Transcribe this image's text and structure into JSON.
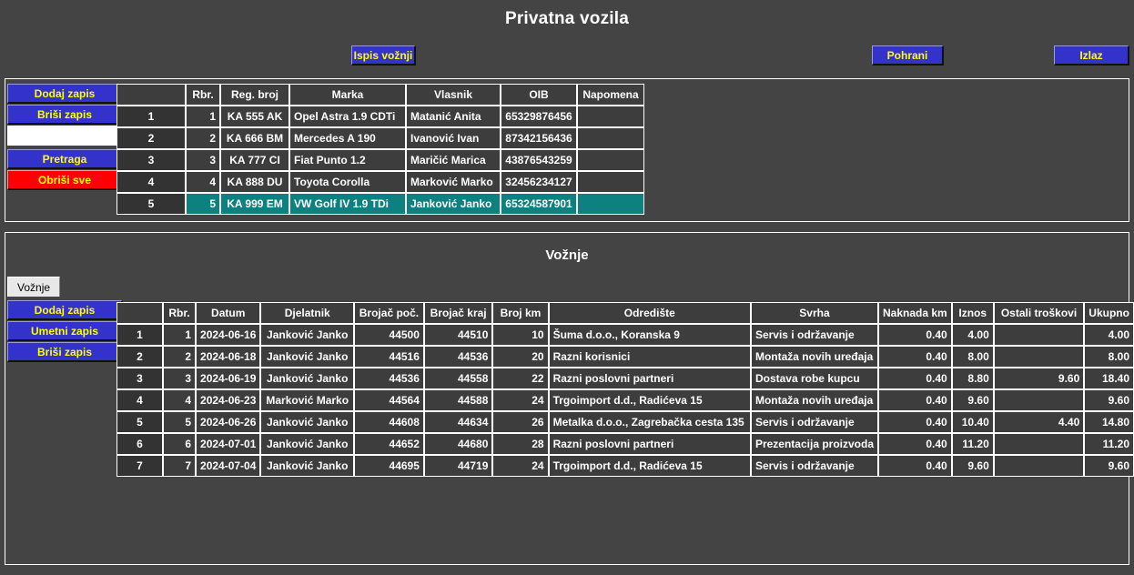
{
  "page": {
    "title": "Privatna vozila",
    "background": "#444444",
    "accent_blue": "#3333cc",
    "accent_yellow": "#ffff00",
    "accent_red": "#ff0000",
    "selection_teal": "#0d8080"
  },
  "toolbar": {
    "print_label": "Ispis vožnji",
    "save_label": "Pohrani",
    "exit_label": "Izlaz"
  },
  "vehicles_panel": {
    "sidebar": {
      "add_label": "Dodaj zapis",
      "delete_label": "Briši zapis",
      "search_value": "",
      "search_placeholder": "",
      "search_label": "Pretraga",
      "clear_all_label": "Obriši sve"
    },
    "columns": [
      "",
      "Rbr.",
      "Reg. broj",
      "Marka",
      "Vlasnik",
      "OIB",
      "Napomena"
    ],
    "rows": [
      {
        "n": "1",
        "rbr": "1",
        "reg": "KA 555 AK",
        "marka": "Opel Astra 1.9 CDTi",
        "vlasnik": "Matanić Anita",
        "oib": "65329876456",
        "napomena": "",
        "selected": false
      },
      {
        "n": "2",
        "rbr": "2",
        "reg": "KA 666 BM",
        "marka": "Mercedes A 190",
        "vlasnik": "Ivanović Ivan",
        "oib": "87342156436",
        "napomena": "",
        "selected": false
      },
      {
        "n": "3",
        "rbr": "3",
        "reg": "KA 777 CI",
        "marka": "Fiat Punto 1.2",
        "vlasnik": "Maričić Marica",
        "oib": "43876543259",
        "napomena": "",
        "selected": false
      },
      {
        "n": "4",
        "rbr": "4",
        "reg": "KA 888 DU",
        "marka": "Toyota Corolla",
        "vlasnik": "Marković Marko",
        "oib": "32456234127",
        "napomena": "",
        "selected": false
      },
      {
        "n": "5",
        "rbr": "5",
        "reg": "KA 999 EM",
        "marka": "VW Golf IV 1.9 TDi",
        "vlasnik": "Janković Janko",
        "oib": "65324587901",
        "napomena": "",
        "selected": true
      }
    ]
  },
  "trips_panel": {
    "title": "Vožnje",
    "tab_label": "Vožnje",
    "sidebar": {
      "add_label": "Dodaj zapis",
      "insert_label": "Umetni zapis",
      "delete_label": "Briši zapis"
    },
    "columns": [
      "",
      "Rbr.",
      "Datum",
      "Djelatnik",
      "Brojač poč.",
      "Brojač kraj",
      "Broj km",
      "Odredište",
      "Svrha",
      "Naknada km",
      "Iznos",
      "Ostali troškovi",
      "Ukupno"
    ],
    "rows": [
      {
        "n": "1",
        "rbr": "1",
        "datum": "2024-06-16",
        "djelatnik": "Janković Janko",
        "poc": "44500",
        "kraj": "44510",
        "km": "10",
        "odrediste": "Šuma d.o.o., Koranska 9",
        "svrha": "Servis i održavanje",
        "naknada": "0.40",
        "iznos": "4.00",
        "ostali": "",
        "ukupno": "4.00"
      },
      {
        "n": "2",
        "rbr": "2",
        "datum": "2024-06-18",
        "djelatnik": "Janković Janko",
        "poc": "44516",
        "kraj": "44536",
        "km": "20",
        "odrediste": "Razni korisnici",
        "svrha": "Montaža novih uređaja",
        "naknada": "0.40",
        "iznos": "8.00",
        "ostali": "",
        "ukupno": "8.00"
      },
      {
        "n": "3",
        "rbr": "3",
        "datum": "2024-06-19",
        "djelatnik": "Janković Janko",
        "poc": "44536",
        "kraj": "44558",
        "km": "22",
        "odrediste": "Razni poslovni partneri",
        "svrha": "Dostava robe kupcu",
        "naknada": "0.40",
        "iznos": "8.80",
        "ostali": "9.60",
        "ukupno": "18.40"
      },
      {
        "n": "4",
        "rbr": "4",
        "datum": "2024-06-23",
        "djelatnik": "Marković Marko",
        "poc": "44564",
        "kraj": "44588",
        "km": "24",
        "odrediste": "Trgoimport d.d., Radićeva 15",
        "svrha": "Montaža novih uređaja",
        "naknada": "0.40",
        "iznos": "9.60",
        "ostali": "",
        "ukupno": "9.60"
      },
      {
        "n": "5",
        "rbr": "5",
        "datum": "2024-06-26",
        "djelatnik": "Janković Janko",
        "poc": "44608",
        "kraj": "44634",
        "km": "26",
        "odrediste": "Metalka d.o.o., Zagrebačka cesta 135",
        "svrha": "Servis i održavanje",
        "naknada": "0.40",
        "iznos": "10.40",
        "ostali": "4.40",
        "ukupno": "14.80"
      },
      {
        "n": "6",
        "rbr": "6",
        "datum": "2024-07-01",
        "djelatnik": "Janković Janko",
        "poc": "44652",
        "kraj": "44680",
        "km": "28",
        "odrediste": "Razni poslovni partneri",
        "svrha": "Prezentacija proizvoda",
        "naknada": "0.40",
        "iznos": "11.20",
        "ostali": "",
        "ukupno": "11.20"
      },
      {
        "n": "7",
        "rbr": "7",
        "datum": "2024-07-04",
        "djelatnik": "Janković Janko",
        "poc": "44695",
        "kraj": "44719",
        "km": "24",
        "odrediste": "Trgoimport d.d., Radićeva 15",
        "svrha": "Servis i održavanje",
        "naknada": "0.40",
        "iznos": "9.60",
        "ostali": "",
        "ukupno": "9.60"
      }
    ]
  }
}
